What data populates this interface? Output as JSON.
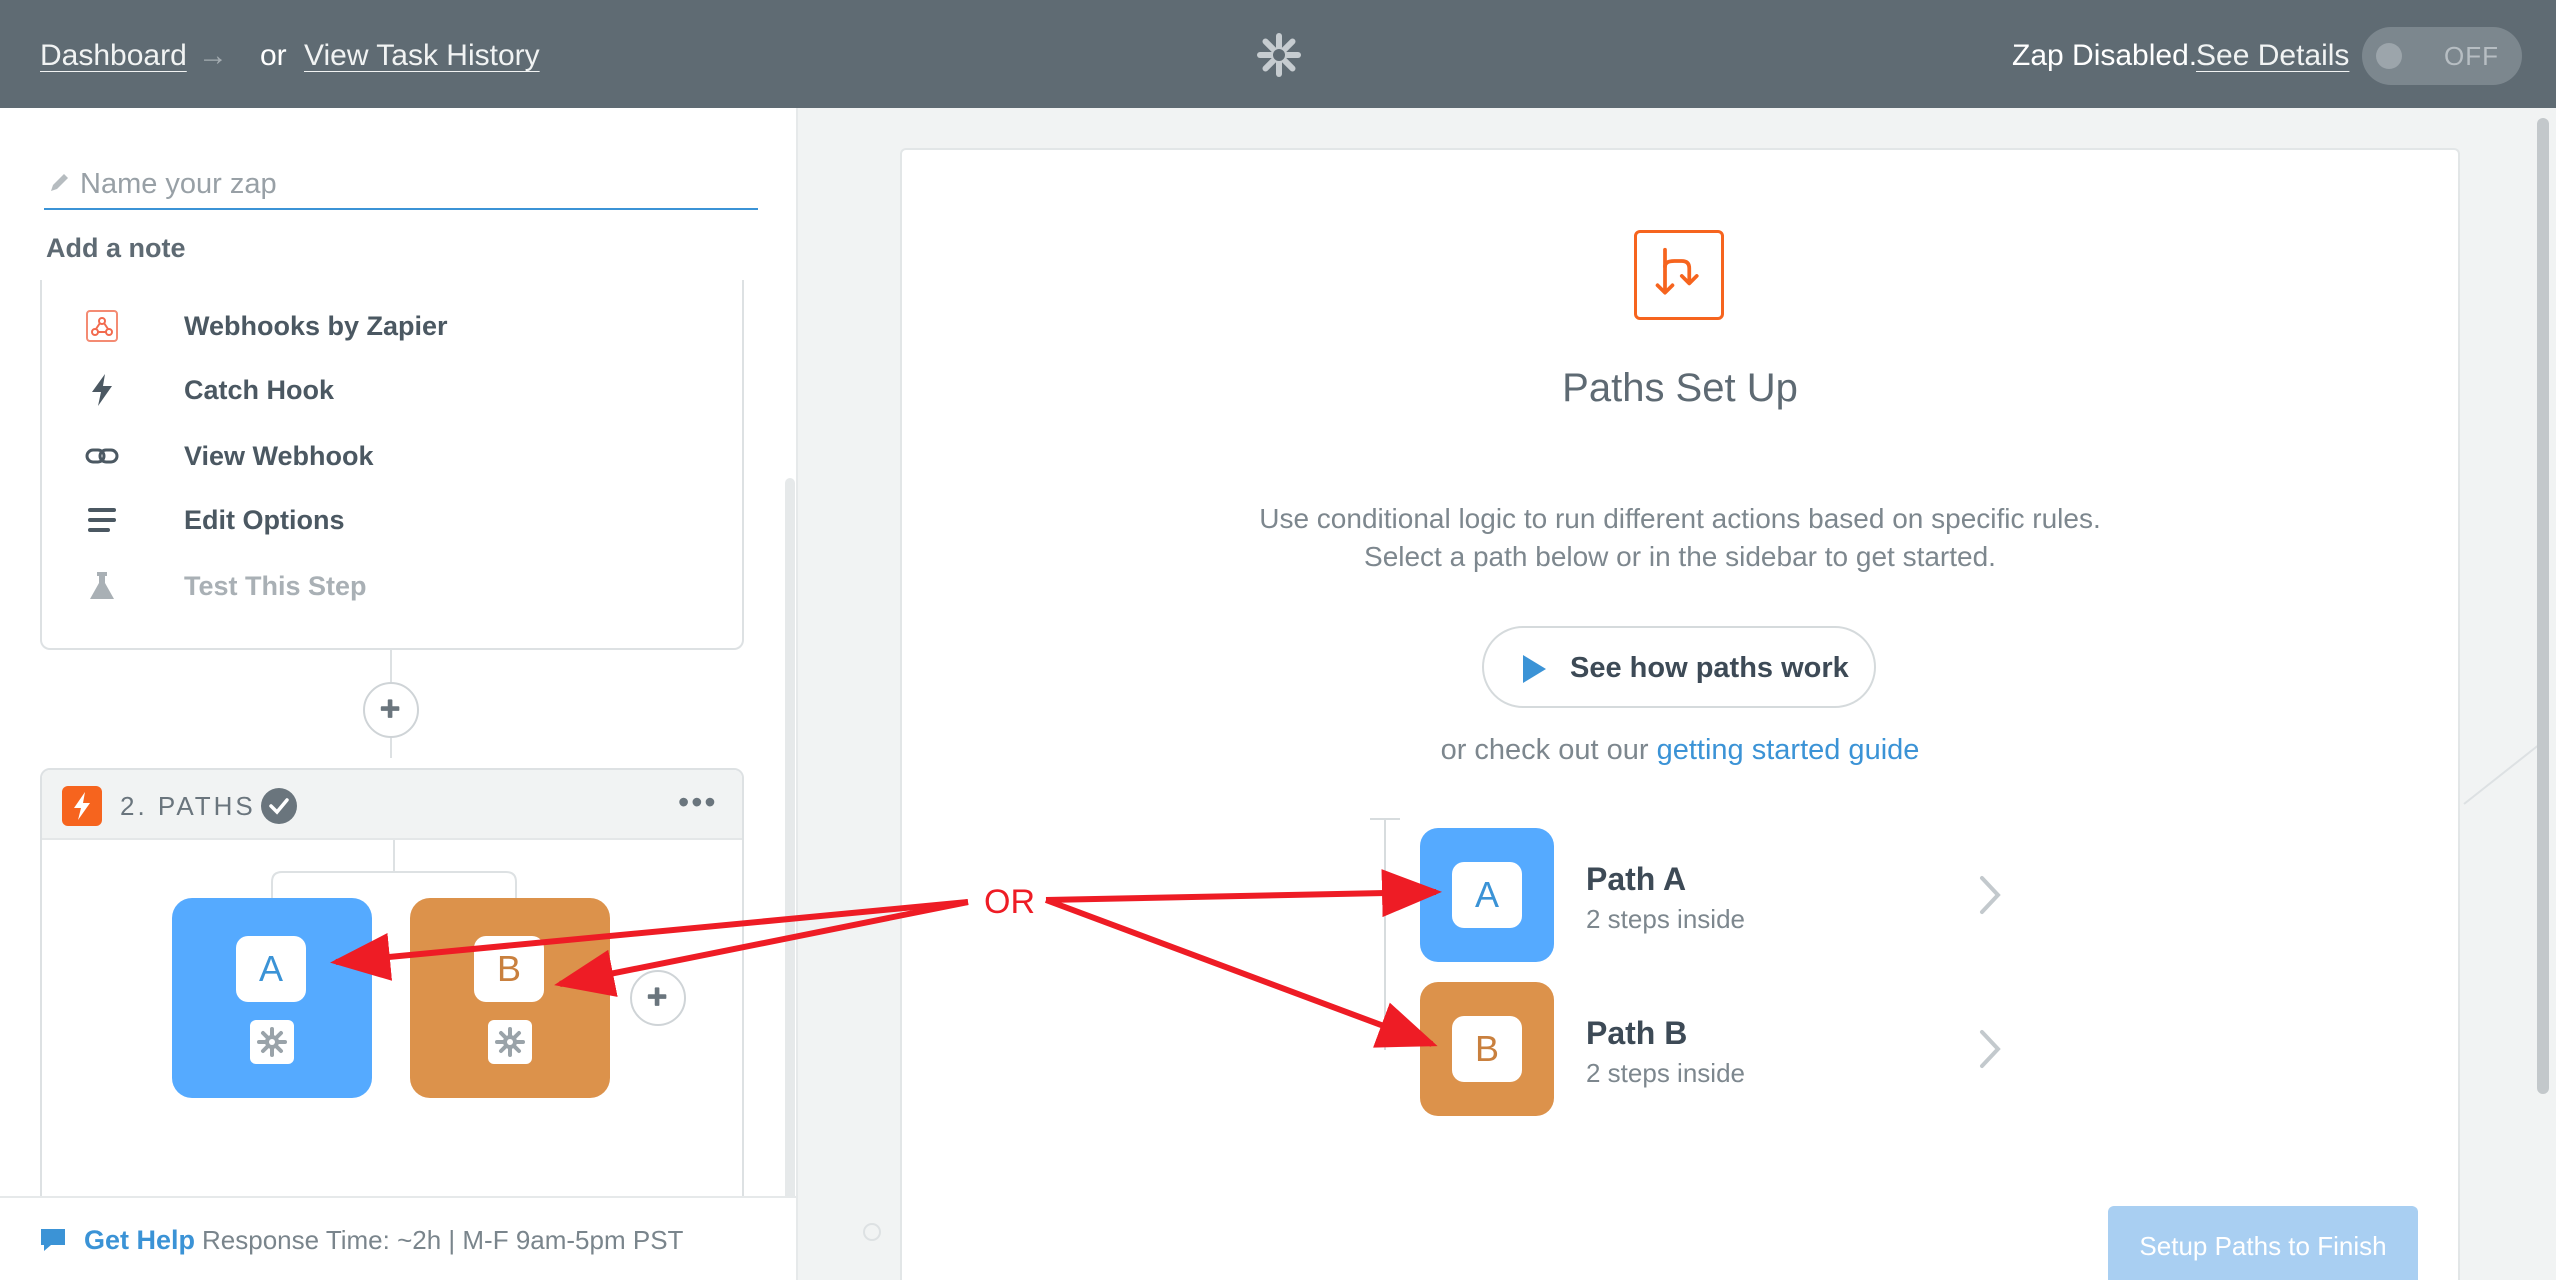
{
  "topbar": {
    "dashboard_link": "Dashboard",
    "arrow": "→",
    "or_text": "or",
    "task_history_link": "View Task History",
    "status_text": "Zap Disabled.",
    "see_details_link": "See Details",
    "toggle_label": "OFF"
  },
  "editor": {
    "name_placeholder": "Name your zap",
    "add_note": "Add a note"
  },
  "step1": {
    "items": [
      {
        "icon": "webhook-icon",
        "label": "Webhooks by Zapier"
      },
      {
        "icon": "lightning-bolt-icon",
        "label": "Catch Hook"
      },
      {
        "icon": "link-icon",
        "label": "View Webhook"
      },
      {
        "icon": "list-lines-icon",
        "label": "Edit Options"
      },
      {
        "icon": "flask-icon",
        "label": "Test This Step"
      }
    ]
  },
  "step2": {
    "title": "2. PATHS",
    "more": "•••",
    "tiles": [
      {
        "letter": "A",
        "color": "#55aaff"
      },
      {
        "letter": "B",
        "color": "#dc924b"
      }
    ]
  },
  "help": {
    "link": "Get Help",
    "text": "Response Time: ~2h | M-F 9am-5pm PST"
  },
  "main": {
    "title": "Paths Set Up",
    "desc_line1": "Use conditional logic to run different actions based on specific rules.",
    "desc_line2": "Select a path below or in the sidebar to get started.",
    "see_how_button": "See how paths work",
    "guide_prefix": "or check out our",
    "guide_link": "getting started guide",
    "paths": [
      {
        "letter": "A",
        "name": "Path A",
        "sub": "2 steps inside",
        "color": "#55aaff"
      },
      {
        "letter": "B",
        "name": "Path B",
        "sub": "2 steps inside",
        "color": "#dc924b"
      }
    ],
    "finish_button": "Setup Paths to Finish"
  },
  "annotation": {
    "label": "OR",
    "color": "#ee1c25"
  },
  "colors": {
    "topbar": "#5f6b73",
    "accent_blue": "#3b93d6",
    "zapier_orange": "#f6641e",
    "path_a": "#55aaff",
    "path_b": "#dc924b"
  }
}
